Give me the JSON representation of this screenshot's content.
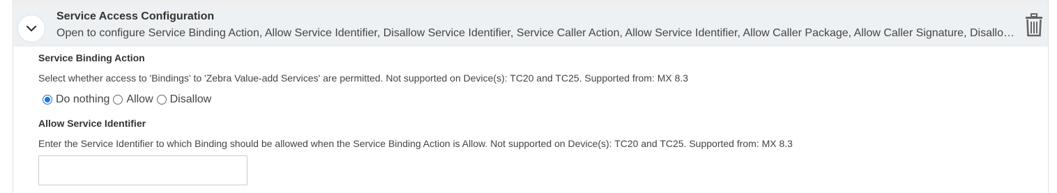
{
  "section": {
    "title": "Service Access Configuration",
    "description": "Open to configure Service Binding Action, Allow Service Identifier, Disallow Service Identifier, Service Caller Action, Allow Service Identifier, Allow Caller Package, Allow Caller Signature, Disallow Service Identifier, Disallow Caller Package, Disallow Caller Signature"
  },
  "fields": {
    "service_binding_action": {
      "label": "Service Binding Action",
      "description": "Select whether access to 'Bindings' to 'Zebra Value-add Services' are permitted. Not supported on Device(s): TC20 and TC25. Supported from: MX 8.3",
      "options": [
        "Do nothing",
        "Allow",
        "Disallow"
      ],
      "selected": "Do nothing"
    },
    "allow_service_identifier": {
      "label": "Allow Service Identifier",
      "description": "Enter the Service Identifier to which Binding should be allowed when the Service Binding Action is Allow. Not supported on Device(s): TC20 and TC25. Supported from: MX 8.3",
      "value": "",
      "placeholder": ""
    }
  },
  "icons": {
    "toggle": "chevron-down-icon",
    "delete": "trash-icon"
  },
  "colors": {
    "header_bg": "#eef1f3",
    "radio_accent": "#1a73e8",
    "icon_gray": "#666666"
  }
}
